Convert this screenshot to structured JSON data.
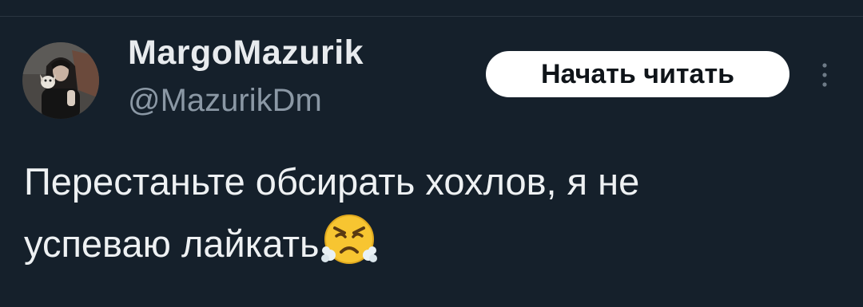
{
  "author": {
    "display_name": "MargoMazurik",
    "handle": "@MazurikDm",
    "avatar_icon": "user-photo-avatar"
  },
  "actions": {
    "follow_label": "Начать читать",
    "more_icon": "more-vertical-icon"
  },
  "tweet": {
    "line1": "Перестаньте обсирать хохлов, я не",
    "line2": "успеваю лайкать",
    "emoji_icon": "face-with-steam-from-nose-emoji"
  },
  "colors": {
    "background": "#15202b",
    "name_text": "#e8ebee",
    "handle_text": "#8b98a5",
    "button_bg": "#ffffff",
    "button_text": "#0f1419",
    "emoji_face": "#f7c531"
  }
}
